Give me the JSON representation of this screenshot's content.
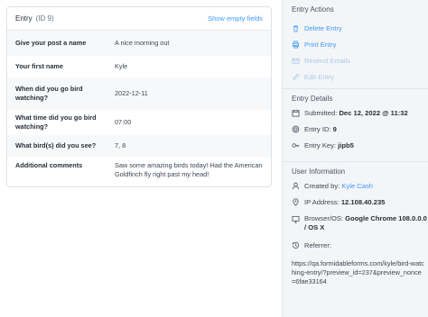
{
  "entry": {
    "title": "Entry",
    "id_label": "(ID 9)",
    "show_empty_fields": "Show empty fields",
    "rows": [
      {
        "label": "Give your post a name",
        "value": "A nice morning out"
      },
      {
        "label": "Your first name",
        "value": "Kyle"
      },
      {
        "label": "When did you go bird watching?",
        "value": "2022-12-11"
      },
      {
        "label": "What time did you go bird watching?",
        "value": "07:00"
      },
      {
        "label": "What bird(s) did you see?",
        "value": "7, 8"
      },
      {
        "label": "Additional comments",
        "value": "Saw some amazing birds today! Had the American Goldfinch fly right past my head!"
      }
    ]
  },
  "actions": {
    "title": "Entry Actions",
    "delete": "Delete Entry",
    "print": "Print Entry",
    "resend": "Resend Emails",
    "edit": "Edit Entry"
  },
  "details": {
    "title": "Entry Details",
    "submitted_label": "Submitted:",
    "submitted_value": "Dec 12, 2022 @ 11:32",
    "entry_id_label": "Entry ID:",
    "entry_id_value": "9",
    "entry_key_label": "Entry Key:",
    "entry_key_value": "jipb5"
  },
  "user_info": {
    "title": "User Information",
    "created_by_label": "Created by:",
    "created_by_value": "Kyle Cash",
    "ip_label": "IP Address:",
    "ip_value": "12.108.40.235",
    "browser_label": "Browser/OS:",
    "browser_value": "Google Chrome 108.0.0.0 / OS X",
    "referrer_label": "Referrer:",
    "referrer_value": "https://qa.formidableforms.com/kyle/bird-watching-entry/?preview_id=237&preview_nonce=6fae33164"
  },
  "colors": {
    "accent": "#4199fd",
    "disabled": "#a9c9ee"
  }
}
